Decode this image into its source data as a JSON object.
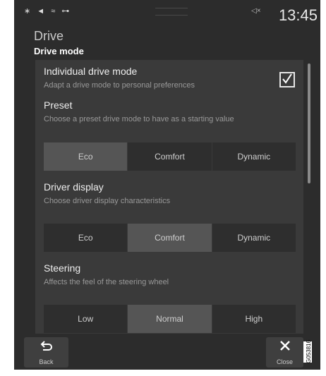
{
  "status_bar": {
    "icons": [
      "bluetooth-icon",
      "location-icon",
      "wifi-icon",
      "usb-icon"
    ],
    "icons_text": "∗ ◄ ≈ ⊶",
    "volume_icon": "volume-muted-icon",
    "volume_text": "◁×",
    "time": "13:45"
  },
  "header": {
    "title": "Drive",
    "subtitle": "Drive mode"
  },
  "individual": {
    "title": "Individual drive mode",
    "description": "Adapt a drive mode to personal preferences",
    "checked": true
  },
  "preset": {
    "title": "Preset",
    "description": "Choose a preset drive mode to have as a starting value",
    "options": [
      "Eco",
      "Comfort",
      "Dynamic"
    ],
    "selected": "Eco"
  },
  "driver_display": {
    "title": "Driver display",
    "description": "Choose driver display characteristics",
    "options": [
      "Eco",
      "Comfort",
      "Dynamic"
    ],
    "selected": "Comfort"
  },
  "steering": {
    "title": "Steering",
    "description": "Affects the feel of the steering wheel",
    "options": [
      "Low",
      "Normal",
      "High"
    ],
    "selected": "Normal"
  },
  "bottom_bar": {
    "back_label": "Back",
    "close_label": "Close"
  },
  "figure_id": "G053816",
  "colors": {
    "background": "#2c2c2c",
    "panel": "#3a3a3a",
    "selected_segment": "#555555",
    "segment": "#2e2e2e"
  }
}
